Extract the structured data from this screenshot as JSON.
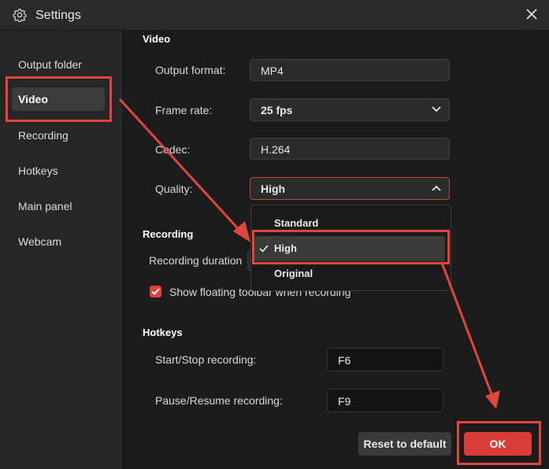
{
  "window": {
    "title": "Settings"
  },
  "sidebar": {
    "items": [
      {
        "label": "Output folder"
      },
      {
        "label": "Video"
      },
      {
        "label": "Recording"
      },
      {
        "label": "Hotkeys"
      },
      {
        "label": "Main panel"
      },
      {
        "label": "Webcam"
      }
    ]
  },
  "video": {
    "section_title": "Video",
    "output_format": {
      "label": "Output format:",
      "value": "MP4"
    },
    "frame_rate": {
      "label": "Frame rate:",
      "value": "25 fps"
    },
    "codec": {
      "label": "Codec:",
      "value": "H.264"
    },
    "quality": {
      "label": "Quality:",
      "value": "High",
      "options": [
        "Standard",
        "High",
        "Original"
      ]
    }
  },
  "recording": {
    "section_title": "Recording",
    "duration_label": "Recording duration",
    "floating_toolbar": {
      "label": "Show floating toolbar when recording",
      "checked": true
    }
  },
  "hotkeys": {
    "section_title": "Hotkeys",
    "start_stop": {
      "label": "Start/Stop recording:",
      "value": "F6"
    },
    "pause_resume": {
      "label": "Pause/Resume recording:",
      "value": "F9"
    }
  },
  "footer": {
    "reset_label": "Reset to default",
    "ok_label": "OK"
  },
  "colors": {
    "accent": "#d93d38",
    "annotation": "#e0463d",
    "background": "#1c1c1c"
  }
}
